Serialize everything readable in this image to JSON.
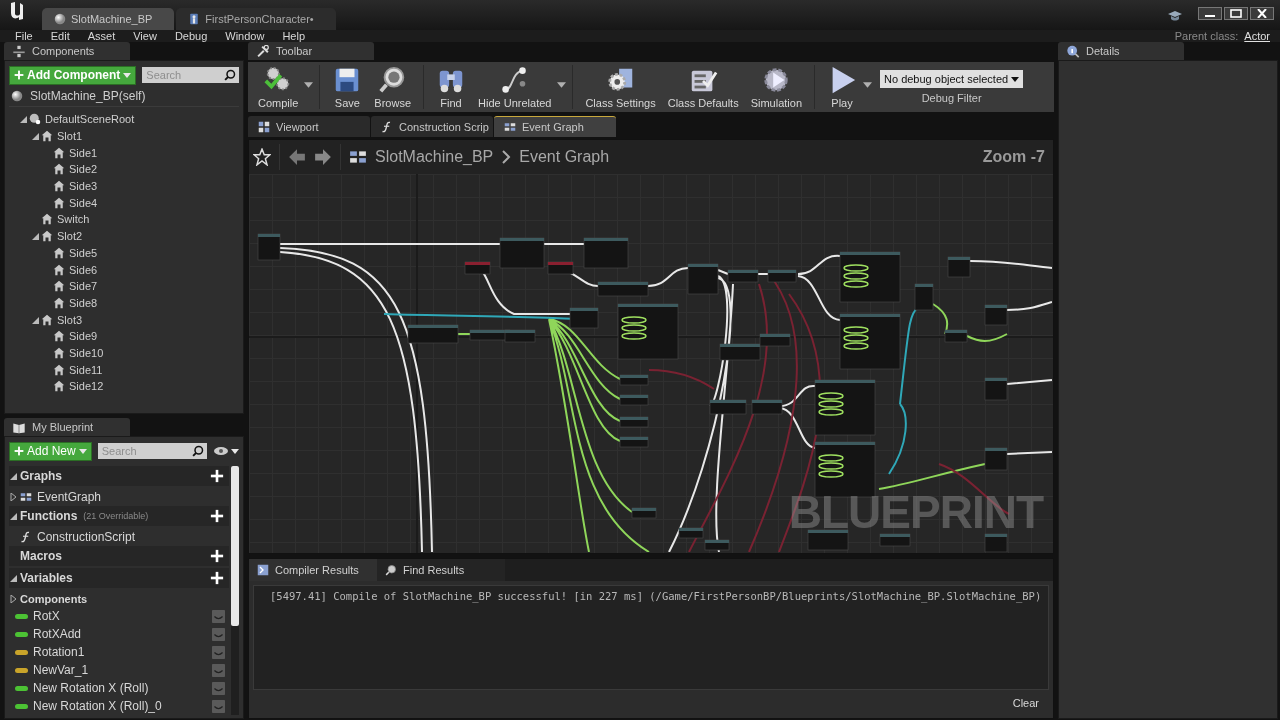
{
  "window": {
    "tabs": [
      {
        "label": "SlotMachine_BP",
        "kind": "blueprint",
        "selected": true
      },
      {
        "label": "FirstPersonCharacter•",
        "kind": "character",
        "selected": false
      }
    ]
  },
  "menu": [
    "File",
    "Edit",
    "Asset",
    "View",
    "Debug",
    "Window",
    "Help"
  ],
  "parent_class": {
    "label": "Parent class:",
    "value": "Actor"
  },
  "components": {
    "title": "Components",
    "add_button": "Add Component",
    "search": {
      "placeholder": "Search"
    },
    "self_item": "SlotMachine_BP(self)",
    "tree": [
      {
        "label": "DefaultSceneRoot",
        "kind": "root",
        "expanded": true,
        "children": [
          {
            "label": "Slot1",
            "kind": "scene",
            "expanded": true,
            "children": [
              {
                "label": "Side1",
                "kind": "scene"
              },
              {
                "label": "Side2",
                "kind": "scene"
              },
              {
                "label": "Side3",
                "kind": "scene"
              },
              {
                "label": "Side4",
                "kind": "scene"
              }
            ]
          },
          {
            "label": "Switch",
            "kind": "scene"
          },
          {
            "label": "Slot2",
            "kind": "scene",
            "expanded": true,
            "children": [
              {
                "label": "Side5",
                "kind": "scene"
              },
              {
                "label": "Side6",
                "kind": "scene"
              },
              {
                "label": "Side7",
                "kind": "scene"
              },
              {
                "label": "Side8",
                "kind": "scene"
              }
            ]
          },
          {
            "label": "Slot3",
            "kind": "scene",
            "expanded": true,
            "children": [
              {
                "label": "Side9",
                "kind": "scene"
              },
              {
                "label": "Side10",
                "kind": "scene"
              },
              {
                "label": "Side11",
                "kind": "scene"
              },
              {
                "label": "Side12",
                "kind": "scene"
              }
            ]
          }
        ]
      }
    ]
  },
  "my_blueprint": {
    "title": "My Blueprint",
    "add_button": "Add New",
    "search": {
      "placeholder": "Search"
    },
    "rows": [
      {
        "kind": "header",
        "label": "Graphs",
        "expanded": true
      },
      {
        "kind": "graph",
        "label": "EventGraph",
        "expanded": false
      },
      {
        "kind": "header",
        "label": "Functions",
        "note": "(21 Overridable)",
        "expanded": true
      },
      {
        "kind": "function",
        "label": "ConstructionScript"
      },
      {
        "kind": "header",
        "label": "Macros"
      },
      {
        "kind": "header",
        "label": "Variables",
        "expanded": true
      },
      {
        "kind": "category",
        "label": "Components",
        "expanded": false
      },
      {
        "kind": "variable",
        "label": "RotX",
        "color": "#4cc234"
      },
      {
        "kind": "variable",
        "label": "RotXAdd",
        "color": "#4cc234"
      },
      {
        "kind": "variable",
        "label": "Rotation1",
        "color": "#c9a42a"
      },
      {
        "kind": "variable",
        "label": "NewVar_1",
        "color": "#c9a42a"
      },
      {
        "kind": "variable",
        "label": "New Rotation X (Roll)",
        "color": "#4cc234"
      },
      {
        "kind": "variable",
        "label": "New Rotation X (Roll)_0",
        "color": "#4cc234"
      }
    ]
  },
  "toolbar": {
    "title": "Toolbar",
    "groups": [
      [
        {
          "label": "Compile",
          "kind": "compile",
          "dropdown": true
        }
      ],
      [
        {
          "label": "Save",
          "kind": "save"
        },
        {
          "label": "Browse",
          "kind": "browse"
        }
      ],
      [
        {
          "label": "Find",
          "kind": "find"
        },
        {
          "label": "Hide Unrelated",
          "kind": "hide",
          "dropdown": true
        }
      ],
      [
        {
          "label": "Class Settings",
          "kind": "settings"
        },
        {
          "label": "Class Defaults",
          "kind": "defaults"
        },
        {
          "label": "Simulation",
          "kind": "simulation"
        }
      ],
      [
        {
          "label": "Play",
          "kind": "play",
          "dropdown": true
        }
      ]
    ],
    "debug": {
      "value": "No debug object selected",
      "label": "Debug Filter"
    }
  },
  "graph": {
    "tabs": [
      {
        "label": "Viewport",
        "kind": "viewport",
        "selected": false
      },
      {
        "label": "Construction Scrip",
        "kind": "function",
        "selected": false
      },
      {
        "label": "Event Graph",
        "kind": "graph",
        "selected": true
      }
    ],
    "breadcrumb": [
      "SlotMachine_BP",
      "Event Graph"
    ],
    "zoom": "Zoom -7",
    "watermark": "BLUEPRINT"
  },
  "results": {
    "tabs": [
      {
        "label": "Compiler Results",
        "kind": "compiler",
        "selected": true
      },
      {
        "label": "Find Results",
        "kind": "find",
        "selected": false
      }
    ],
    "messages": [
      "[5497.41] Compile of SlotMachine_BP successful! [in 227 ms] (/Game/FirstPersonBP/Blueprints/SlotMachine_BP.SlotMachine_BP)"
    ],
    "clear_button": "Clear"
  },
  "details": {
    "title": "Details"
  }
}
